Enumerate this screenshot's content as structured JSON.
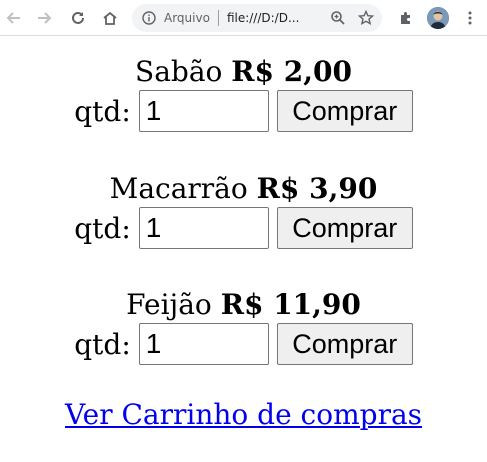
{
  "browser": {
    "omnibox_label": "Arquivo",
    "url": "file:///D:/D..."
  },
  "products": [
    {
      "name": "Sabão",
      "price": "R$ 2,00",
      "qty_label": "qtd:",
      "qty_value": "1",
      "buy_label": "Comprar"
    },
    {
      "name": "Macarrão",
      "price": "R$ 3,90",
      "qty_label": "qtd:",
      "qty_value": "1",
      "buy_label": "Comprar"
    },
    {
      "name": "Feijão",
      "price": "R$ 11,90",
      "qty_label": "qtd:",
      "qty_value": "1",
      "buy_label": "Comprar"
    }
  ],
  "cart_link": "Ver Carrinho de compras",
  "colors": {
    "link": "#0000ee",
    "button_bg": "#efefef",
    "omnibox_bg": "#f1f3f4"
  }
}
